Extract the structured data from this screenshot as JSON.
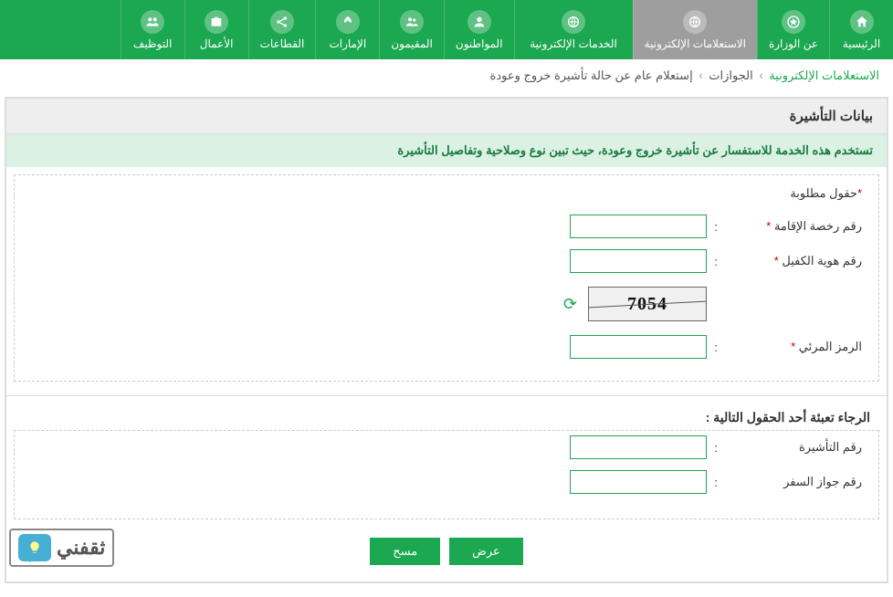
{
  "nav": [
    {
      "label": "الرئيسية",
      "icon": "home"
    },
    {
      "label": "عن الوزارة",
      "icon": "emblem"
    },
    {
      "label": "الاستعلامات الإلكترونية",
      "icon": "globe-search",
      "active": true,
      "wide": true
    },
    {
      "label": "الخدمات الإلكترونية",
      "icon": "globe",
      "wide": true
    },
    {
      "label": "المواطنون",
      "icon": "person"
    },
    {
      "label": "المقيمون",
      "icon": "group"
    },
    {
      "label": "الإمارات",
      "icon": "leaf"
    },
    {
      "label": "القطاعات",
      "icon": "share"
    },
    {
      "label": "الأعمال",
      "icon": "briefcase"
    },
    {
      "label": "التوظيف",
      "icon": "people"
    }
  ],
  "breadcrumb": {
    "root": "الاستعلامات الإلكترونية",
    "mid": "الجوازات",
    "leaf": "إستعلام عام عن حالة تأشيرة خروج وعودة"
  },
  "panel": {
    "title": "بيانات التأشيرة",
    "info": "تستخدم هذه الخدمة للاستفسار عن تأشيرة خروج وعودة، حيث تبين نوع وصلاحية وتفاصيل التأشيرة",
    "required_note": "حقول مطلوبة",
    "fields": {
      "iqama": "رقم رخصة الإقامة",
      "sponsor": "رقم هوية الكفيل",
      "captcha_code": "الرمز المرئي"
    },
    "captcha_text": "7054",
    "section2_title": "الرجاء تعبئة أحد الحقول التالية :",
    "fields2": {
      "visa_no": "رقم التأشيرة",
      "passport_no": "رقم جواز السفر"
    },
    "buttons": {
      "submit": "عرض",
      "clear": "مسح"
    }
  },
  "watermark": "ثقفني"
}
